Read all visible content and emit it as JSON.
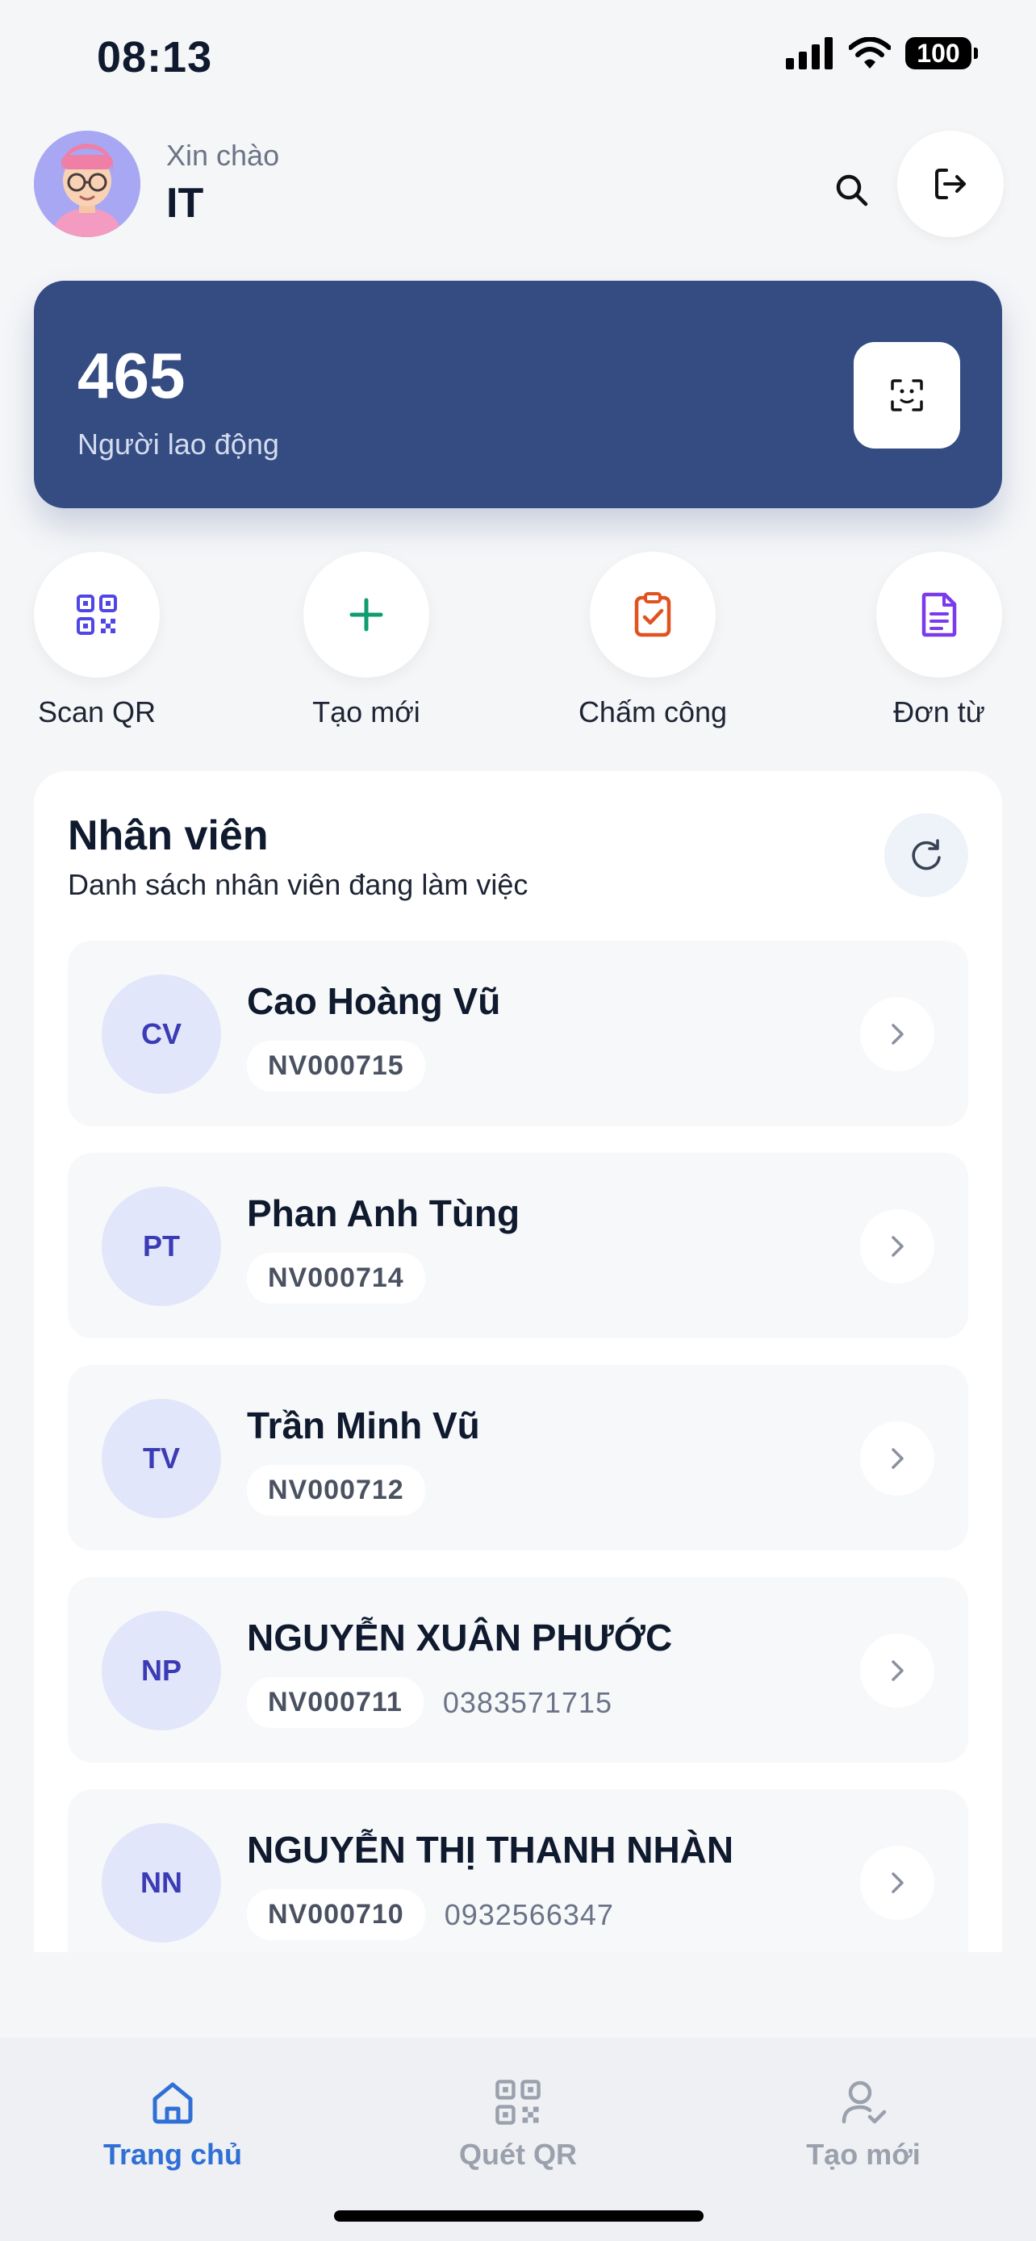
{
  "status_bar": {
    "time": "08:13",
    "battery": "100"
  },
  "header": {
    "greeting": "Xin chào",
    "user_name": "IT"
  },
  "stats": {
    "count": "465",
    "label": "Người lao động"
  },
  "quick_actions": [
    {
      "label": "Scan QR",
      "icon": "qr-code-icon",
      "color": "#4f46e5"
    },
    {
      "label": "Tạo mới",
      "icon": "plus-icon",
      "color": "#0f9d70"
    },
    {
      "label": "Chấm công",
      "icon": "clipboard-check-icon",
      "color": "#e0531f"
    },
    {
      "label": "Đơn từ",
      "icon": "document-icon",
      "color": "#7c3aed"
    }
  ],
  "employees": {
    "title": "Nhân viên",
    "subtitle": "Danh sách nhân viên đang làm việc",
    "items": [
      {
        "initials": "CV",
        "name": "Cao Hoàng Vũ",
        "code": "NV000715",
        "phone": ""
      },
      {
        "initials": "PT",
        "name": "Phan Anh Tùng",
        "code": "NV000714",
        "phone": ""
      },
      {
        "initials": "TV",
        "name": "Trần Minh Vũ",
        "code": "NV000712",
        "phone": ""
      },
      {
        "initials": "NP",
        "name": "NGUYỄN XUÂN PHƯỚC",
        "code": "NV000711",
        "phone": "0383571715"
      },
      {
        "initials": "NN",
        "name": "NGUYỄN THỊ THANH NHÀN",
        "code": "NV000710",
        "phone": "0932566347"
      }
    ]
  },
  "bottom_nav": [
    {
      "label": "Trang chủ",
      "icon": "home-icon",
      "active": true
    },
    {
      "label": "Quét QR",
      "icon": "qr-code-icon",
      "active": false
    },
    {
      "label": "Tạo mới",
      "icon": "user-check-icon",
      "active": false
    }
  ],
  "colors": {
    "accent": "#344c82",
    "active_nav": "#2f6fd6",
    "inactive_nav": "#9aa1ad"
  }
}
